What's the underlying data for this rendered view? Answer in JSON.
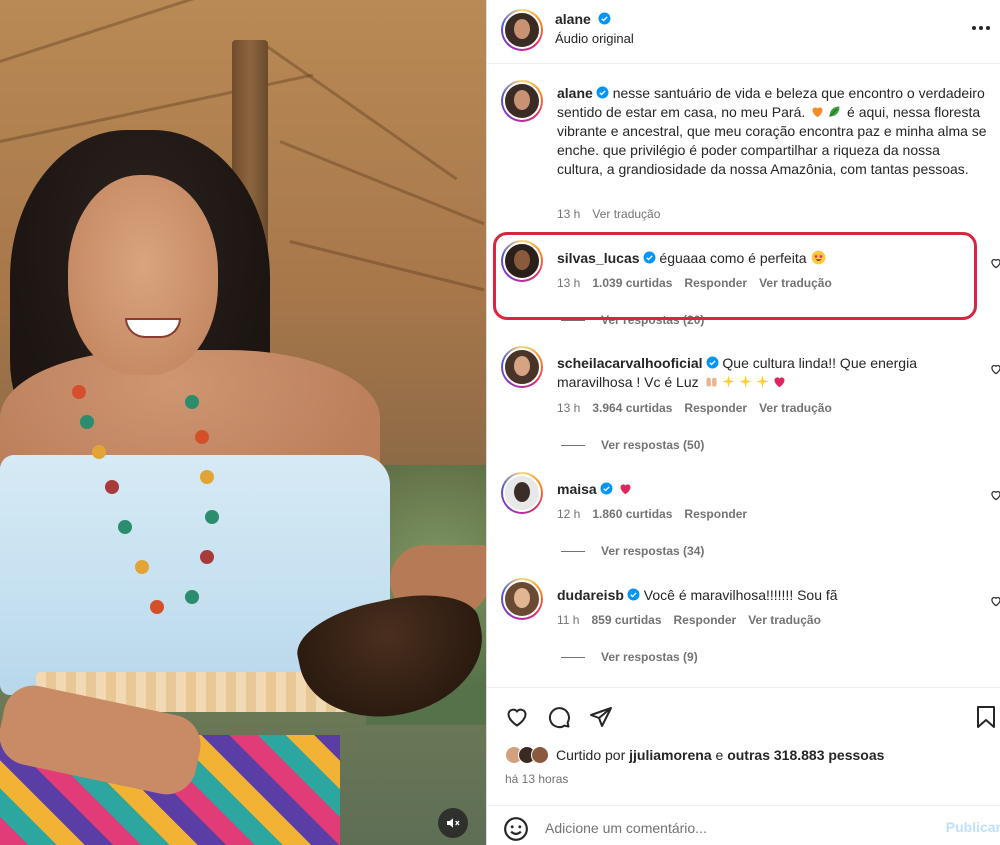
{
  "post": {
    "author": "alane",
    "audio": "Áudio original",
    "caption": {
      "username": "alane",
      "text": "nesse santuário de vida e beleza que encontro o verdadeiro sentido de estar em casa, no meu Pará.",
      "text_after_emoji": "é aqui, nessa floresta vibrante e ancestral, que meu coração encontra paz e minha alma se enche. que privilégio é poder compartilhar a riqueza da nossa cultura, a grandiosidade da nossa Amazônia, com tantas pessoas.",
      "emojis": [
        "orange-heart",
        "leaf"
      ],
      "time": "13 h",
      "translate": "Ver tradução"
    }
  },
  "comments": [
    {
      "username": "silvas_lucas",
      "text": "éguaaa como é perfeita",
      "emoji": "star-eyes",
      "time": "13 h",
      "likes": "1.039 curtidas",
      "reply": "Responder",
      "translate": "Ver tradução",
      "replies": "Ver respostas (20)",
      "highlighted": true
    },
    {
      "username": "scheilacarvalhooficial",
      "text": "Que cultura linda!! Que energia",
      "text_line2": "maravilhosa ! Vc é Luz",
      "emoji_tail": [
        "raised-hands",
        "sparkles",
        "sparkles",
        "sparkles",
        "red-heart"
      ],
      "time": "13 h",
      "likes": "3.964 curtidas",
      "reply": "Responder",
      "translate": "Ver tradução",
      "replies": "Ver respostas (50)"
    },
    {
      "username": "maisa",
      "text": "",
      "emoji": "red-heart",
      "time": "12 h",
      "likes": "1.860 curtidas",
      "reply": "Responder",
      "replies": "Ver respostas (34)"
    },
    {
      "username": "dudareisb",
      "text": "Você é maravilhosa!!!!!!! Sou fã",
      "time": "11 h",
      "likes": "859 curtidas",
      "reply": "Responder",
      "translate": "Ver tradução",
      "replies": "Ver respostas (9)"
    }
  ],
  "footer": {
    "liked_prefix": "Curtido por",
    "liked_user": "jjuliamorena",
    "liked_middle": "e",
    "liked_others": "outras 318.883 pessoas",
    "time_ago": "há 13 horas",
    "comment_placeholder": "Adicione um comentário...",
    "publish": "Publicar"
  },
  "colors": {
    "highlight": "#d7263d",
    "verified": "#0095f6",
    "meta": "#737373",
    "publish_disabled": "#c0dffd"
  },
  "icons": [
    "more-icon",
    "heart-icon",
    "comment-icon",
    "share-icon",
    "bookmark-icon",
    "emoji-icon",
    "mute-icon",
    "verified-icon"
  ]
}
